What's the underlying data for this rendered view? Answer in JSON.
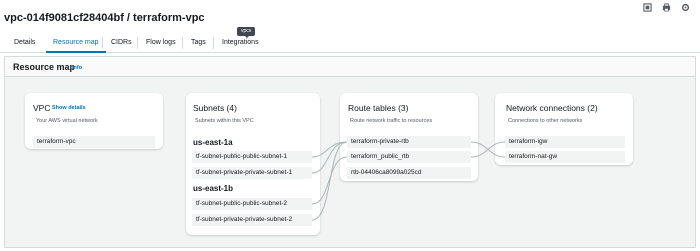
{
  "header": {
    "title": "vpc-014f9081cf28404bf / terraform-vpc",
    "tools": [
      "fullscreen-icon",
      "print-icon",
      "settings-icon"
    ]
  },
  "tabs": [
    {
      "label": "Details",
      "active": false
    },
    {
      "label": "Resource map",
      "active": true
    },
    {
      "label": "CIDRs",
      "active": false
    },
    {
      "label": "Flow logs",
      "active": false
    },
    {
      "label": "Tags",
      "active": false
    },
    {
      "label": "Integrations",
      "active": false
    }
  ],
  "tooltip": {
    "text": "vpcs"
  },
  "resource_map": {
    "title": "Resource map",
    "info_label": "Info",
    "vpc": {
      "title": "VPC",
      "show_details": "Show details",
      "subtitle": "Your AWS virtual network",
      "items": [
        "terraform-vpc"
      ]
    },
    "subnets": {
      "title": "Subnets (4)",
      "subtitle": "Subnets within this VPC",
      "zones": [
        {
          "name": "us-east-1a",
          "items": [
            "tf-subnet-public-public-subnet-1",
            "tf-subnet-private-private-subnet-1"
          ]
        },
        {
          "name": "us-east-1b",
          "items": [
            "tf-subnet-public-public-subnet-2",
            "tf-subnet-private-private-subnet-2"
          ]
        }
      ]
    },
    "route_tables": {
      "title": "Route tables (3)",
      "subtitle": "Route network traffic to resources",
      "items": [
        "terraform-private-rtb",
        "terraform_public_rtb",
        "rtb-04406ca8099a025cd"
      ]
    },
    "network_connections": {
      "title": "Network connections (2)",
      "subtitle": "Connections to other networks",
      "items": [
        "terraform-igw",
        "terraform-nat-gw"
      ]
    }
  },
  "colors": {
    "accent": "#0073bb",
    "panel_bg": "#f2f3f3",
    "connector": "#aab7b8"
  }
}
